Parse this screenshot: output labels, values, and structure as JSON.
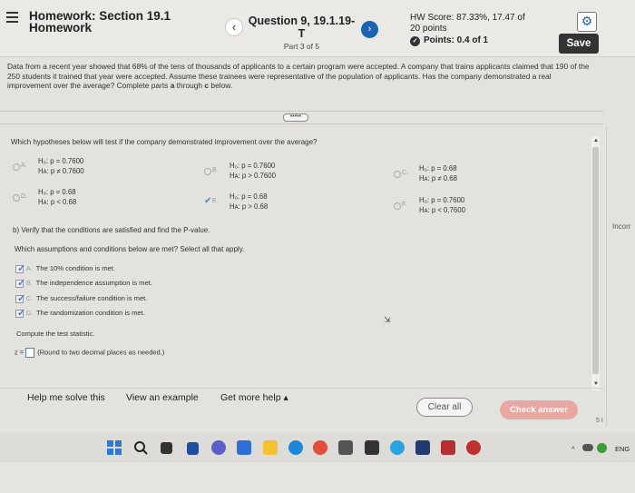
{
  "header": {
    "course_line1": "Homework: Section 19.1",
    "course_line2": "Homework",
    "question_title": "Question 9, 19.1.19-T",
    "question_part": "Part 3 of 5",
    "prev_icon": "‹",
    "next_icon": "›",
    "hw_score": "HW Score: 87.33%, 17.47 of",
    "hw_points": "20 points",
    "points_label": "Points: 0.4 of 1",
    "save_label": "Save",
    "settings_icon": "gear-icon"
  },
  "problem": {
    "text_before": "Data from a recent year showed that 68% of the tens of thousands of applicants to a certain program were accepted. A company that trains applicants claimed that 190 of the 250 students it trained that year were accepted. Assume these trainees were representative of the population of applicants. Has the company demonstrated a real improvement over the average? Complete parts ",
    "bold_a": "a",
    "through": " through ",
    "bold_c": "c",
    "text_after": " below.",
    "expand_label": "•••••"
  },
  "question": {
    "prompt": "Which hypotheses below will test if the company demonstrated improvement over the average?",
    "options": [
      {
        "letter": "A.",
        "h0": "H₀: p = 0.7600",
        "ha": "Hᴀ: p ≠ 0.7600"
      },
      {
        "letter": "B.",
        "h0": "H₀: p = 0.7600",
        "ha": "Hᴀ: p > 0.7600"
      },
      {
        "letter": "C.",
        "h0": "H₀: p = 0.68",
        "ha": "Hᴀ: p ≠ 0.68"
      },
      {
        "letter": "D.",
        "h0": "H₀: p = 0.68",
        "ha": "Hᴀ: p < 0.68"
      },
      {
        "letter": "E.",
        "h0": "H₀: p = 0.68",
        "ha": "Hᴀ: p > 0.68"
      },
      {
        "letter": "F.",
        "h0": "H₀: p = 0.7600",
        "ha": "Hᴀ: p < 0.7600"
      }
    ],
    "selected": "E"
  },
  "part_b": {
    "title": "b) Verify that the conditions are satisfied and find the P-value.",
    "prompt": "Which assumptions and conditions below are met? Select all that apply.",
    "conditions": [
      {
        "letter": "A.",
        "text": "The 10% condition is met."
      },
      {
        "letter": "B.",
        "text": "The independence assumption is met."
      },
      {
        "letter": "C.",
        "text": "The success/failure condition is met."
      },
      {
        "letter": "D.",
        "text": "The randomization condition is met."
      }
    ],
    "compute_prompt": "Compute the test statistic.",
    "z_label": "z =",
    "z_hint": "(Round to two decimal places as needed.)"
  },
  "footer": {
    "help_label": "Help me solve this",
    "example_label": "View an example",
    "more_help_label": "Get more help ▴",
    "clear_label": "Clear all",
    "check_label": "Check answer"
  },
  "side": {
    "incorrect_text": "Incorr",
    "page_num": "5 I"
  },
  "taskbar": {
    "tray_lang": "ENG",
    "tray_chevron": "^"
  }
}
